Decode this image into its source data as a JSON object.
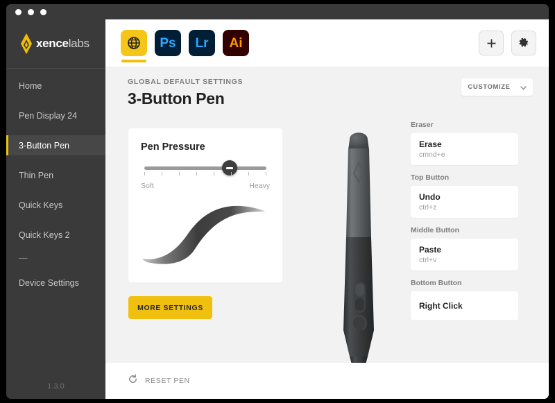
{
  "window": {
    "traffic_lights": [
      "close",
      "minimize",
      "maximize"
    ]
  },
  "sidebar": {
    "brand_bold": "xence",
    "brand_light": "labs",
    "logo_icon": "xencelabs-flame-icon",
    "items": [
      {
        "label": "Home",
        "active": false
      },
      {
        "label": "Pen Display 24",
        "active": false
      },
      {
        "label": "3-Button Pen",
        "active": true
      },
      {
        "label": "Thin Pen",
        "active": false
      },
      {
        "label": "Quick Keys",
        "active": false
      },
      {
        "label": "Quick Keys 2",
        "active": false
      }
    ],
    "divider_dash": "—",
    "device_settings": "Device Settings",
    "version": "1.3.0"
  },
  "toolbar": {
    "apps": [
      {
        "label": "",
        "icon": "globe-icon",
        "kind": "globe",
        "active": true
      },
      {
        "label": "Ps",
        "icon": "photoshop-icon",
        "kind": "ps",
        "active": false
      },
      {
        "label": "Lr",
        "icon": "lightroom-icon",
        "kind": "lr",
        "active": false
      },
      {
        "label": "Ai",
        "icon": "illustrator-icon",
        "kind": "ai",
        "active": false
      }
    ],
    "add_button_icon": "plus-icon",
    "settings_button_icon": "gear-icon"
  },
  "header": {
    "eyebrow": "GLOBAL DEFAULT SETTINGS",
    "title": "3-Button Pen",
    "customize_label": "CUSTOMIZE",
    "customize_icon": "chevron-down-icon"
  },
  "pressure": {
    "title": "Pen Pressure",
    "slider": {
      "min_label": "Soft",
      "max_label": "Heavy",
      "value_percent": 70,
      "tick_count": 8
    },
    "curve_preview_icon": "pen-stroke-curve"
  },
  "more_settings_label": "MORE SETTINGS",
  "pen": {
    "image_name": "3-button-pen-illustration"
  },
  "mappings": [
    {
      "label": "Eraser",
      "action": "Erase",
      "shortcut": "cmnd+e"
    },
    {
      "label": "Top Button",
      "action": "Undo",
      "shortcut": "ctrl+z"
    },
    {
      "label": "Middle Button",
      "action": "Paste",
      "shortcut": "ctrl+v"
    },
    {
      "label": "Bottom Button",
      "action": "Right Click",
      "shortcut": ""
    }
  ],
  "footer": {
    "reset_label": "RESET PEN",
    "reset_icon": "refresh-icon"
  },
  "colors": {
    "accent": "#f0c010",
    "sidebar_bg": "#3a3a3a",
    "content_bg": "#f2f2f2"
  }
}
